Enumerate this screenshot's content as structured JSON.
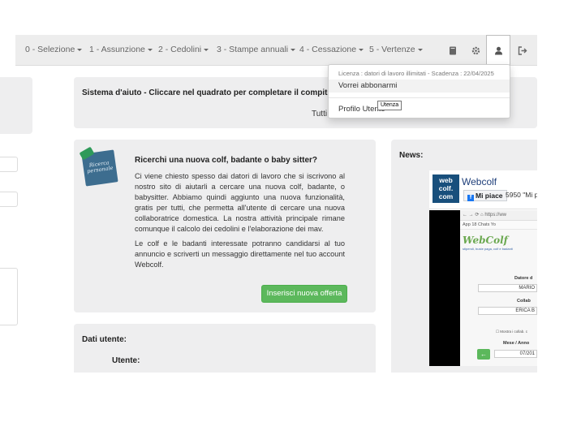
{
  "navbar": {
    "items": [
      {
        "label": "0 - Selezione"
      },
      {
        "label": "1 - Assunzione"
      },
      {
        "label": "2 - Cedolini"
      },
      {
        "label": "3 - Stampe annuali"
      },
      {
        "label": "4 - Cessazione"
      },
      {
        "label": "5 - Vertenze"
      }
    ],
    "icons": [
      "book-icon",
      "gear-icon",
      "user-icon",
      "logout-icon"
    ]
  },
  "help_panel": {
    "title": "Sistema d'aiuto - Cliccare nel quadrato per completare il compito:",
    "subtitle": "Tutti"
  },
  "promo": {
    "note_text": "Ricerca personale",
    "title": "Ricerchi una nuova colf, badante o baby sitter?",
    "paragraph1": "Ci viene chiesto spesso dai datori di lavoro che si iscrivono al nostro sito di aiutarli a cercare una nuova colf, badante, o babysitter. Abbiamo quindi aggiunto una nuova funzionalità, gratis per tutti, che permetta all'utente di cercare una nuova collaboratrice domestica. La nostra attività principale rimane comunque il calcolo dei cedolini e l'elaborazione dei mav.",
    "paragraph2": "Le colf e le badanti interessate potranno candidarsi al tuo annuncio e scriverti un messaggio direttamente nel tuo account Webcolf.",
    "button": "Inserisci nuova offerta"
  },
  "user_panel": {
    "title": "Dati utente:",
    "label": "Utente:"
  },
  "news": {
    "title": "News:",
    "fb": {
      "logo_line1": "web",
      "logo_line2": "colf.",
      "logo_line3": "com",
      "page_name": "Webcolf",
      "like_button": "Mi piace",
      "fans": "5950 \"Mi pi",
      "browser_url": "https://ww",
      "bookmarks": "App  18  Chats  Yo",
      "brand": "WebColf",
      "tagline": "stipendi, buste paga, colf e badanti",
      "field1_label": "Datore d",
      "field1_value": "MARIO",
      "field2_label": "Collab",
      "field2_value": "ERICA B",
      "checkbox_label": "Mostra i collab. c",
      "field3_label": "Mese / Anno",
      "field3_value": "07/201",
      "back_arrow": "←"
    }
  },
  "dropdown": {
    "license": "Licenza : datori di lavoro illimitati - Scadenza : 22/04/2025",
    "item1": "Vorrei abbonarmi",
    "item2": "Profilo Utente"
  },
  "tooltip": "Utenza"
}
